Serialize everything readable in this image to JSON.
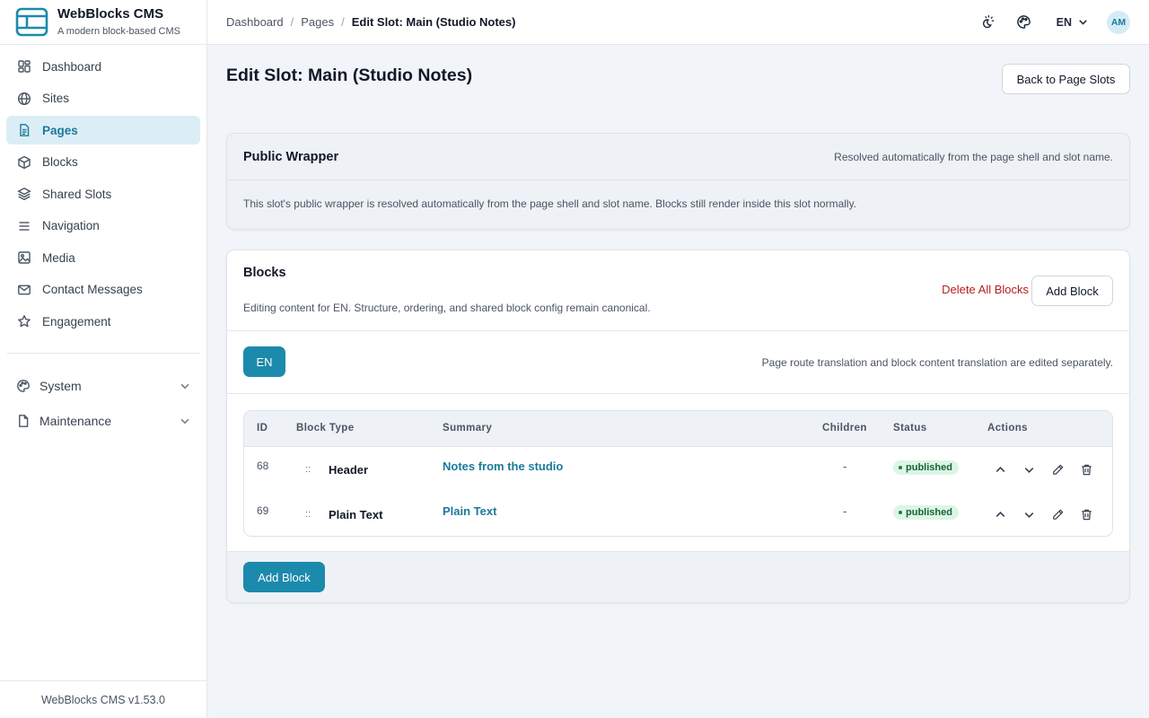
{
  "app": {
    "name": "WebBlocks CMS",
    "tagline": "A modern block-based CMS",
    "version": "WebBlocks CMS v1.53.0"
  },
  "sidebar": {
    "items": [
      {
        "label": "Dashboard",
        "icon": "grid-icon",
        "active": false
      },
      {
        "label": "Sites",
        "icon": "globe-icon",
        "active": false
      },
      {
        "label": "Pages",
        "icon": "document-icon",
        "active": true
      },
      {
        "label": "Blocks",
        "icon": "cube-icon",
        "active": false
      },
      {
        "label": "Shared Slots",
        "icon": "layers-icon",
        "active": false
      },
      {
        "label": "Navigation",
        "icon": "menu-icon",
        "active": false
      },
      {
        "label": "Media",
        "icon": "image-icon",
        "active": false
      },
      {
        "label": "Contact Messages",
        "icon": "mail-icon",
        "active": false
      },
      {
        "label": "Engagement",
        "icon": "star-icon",
        "active": false
      }
    ],
    "groups": [
      {
        "label": "System",
        "icon": "palette-icon"
      },
      {
        "label": "Maintenance",
        "icon": "file-icon"
      }
    ]
  },
  "topbar": {
    "breadcrumbs": [
      "Dashboard",
      "Pages",
      "Edit Slot: Main (Studio Notes)"
    ],
    "language": "EN",
    "avatar": "AM"
  },
  "page": {
    "title": "Edit Slot: Main (Studio Notes)",
    "back_label": "Back to Page Slots"
  },
  "wrapper": {
    "title": "Public Wrapper",
    "hint": "Resolved automatically from the page shell and slot name.",
    "body": "This slot's public wrapper is resolved automatically from the page shell and slot name. Blocks still render inside this slot normally."
  },
  "blocks": {
    "title": "Blocks",
    "subtitle": "Editing content for EN. Structure, ordering, and shared block config remain canonical.",
    "delete_all_label": "Delete All Blocks",
    "add_label": "Add Block",
    "lang_pill": "EN",
    "lang_note": "Page route translation and block content translation are edited separately.",
    "columns": [
      "ID",
      "Block Type",
      "Summary",
      "Children",
      "Status",
      "Actions"
    ],
    "rows": [
      {
        "id": "68",
        "drag": "::",
        "type": "Header",
        "summary": "Notes from the studio",
        "children": "-",
        "status": "published"
      },
      {
        "id": "69",
        "drag": "::",
        "type": "Plain Text",
        "summary": "Plain Text",
        "children": "-",
        "status": "published"
      }
    ],
    "footer_add_label": "Add Block"
  },
  "colors": {
    "accent": "#1c8aac",
    "danger": "#b91c1c",
    "status_published_bg": "#dcf5e6"
  }
}
